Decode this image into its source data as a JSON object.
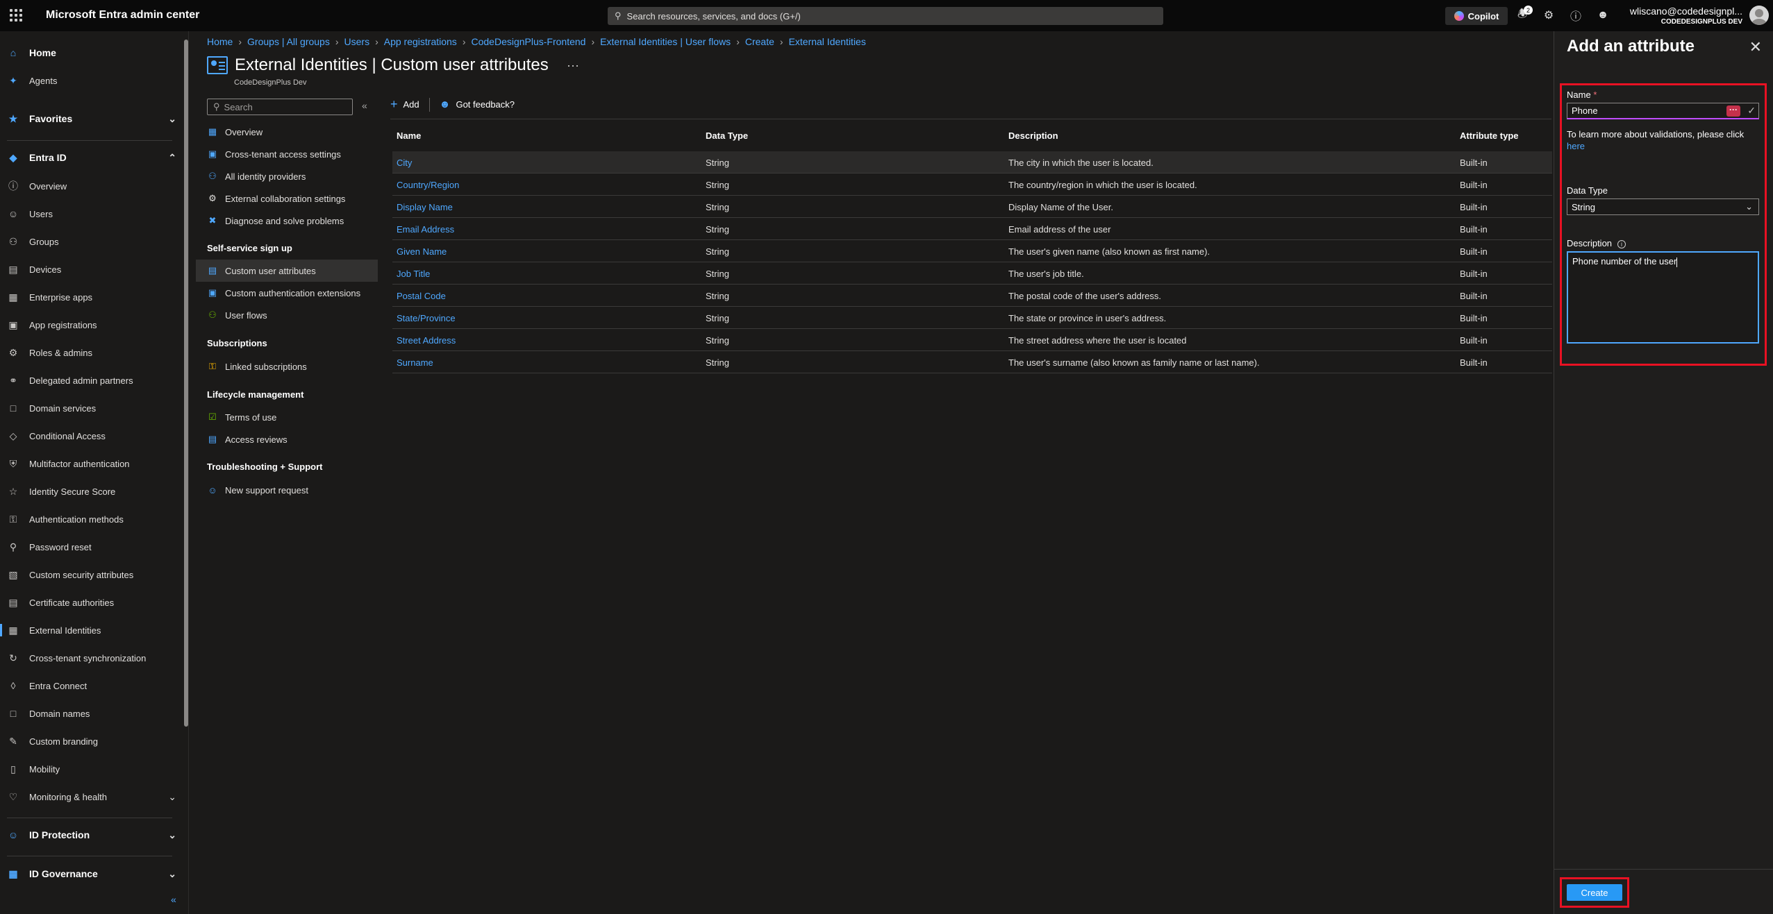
{
  "topbar": {
    "brand": "Microsoft Entra admin center",
    "search_placeholder": "Search resources, services, and docs (G+/)",
    "copilot_label": "Copilot",
    "notification_count": "2",
    "user_email": "wliscano@codedesignpl...",
    "user_tenant": "CODEDESIGNPLUS DEV"
  },
  "leftnav": {
    "home": "Home",
    "agents": "Agents",
    "favorites": "Favorites",
    "entra_id": "Entra ID",
    "items": [
      "Overview",
      "Users",
      "Groups",
      "Devices",
      "Enterprise apps",
      "App registrations",
      "Roles & admins",
      "Delegated admin partners",
      "Domain services",
      "Conditional Access",
      "Multifactor authentication",
      "Identity Secure Score",
      "Authentication methods",
      "Password reset",
      "Custom security attributes",
      "Certificate authorities",
      "External Identities",
      "Cross-tenant synchronization",
      "Entra Connect",
      "Domain names",
      "Custom branding",
      "Mobility",
      "Monitoring & health"
    ],
    "id_protection": "ID Protection",
    "id_governance": "ID Governance"
  },
  "breadcrumb": [
    "Home",
    "Groups | All groups",
    "Users",
    "App registrations",
    "CodeDesignPlus-Frontend",
    "External Identities | User flows",
    "Create",
    "External Identities"
  ],
  "page": {
    "title": "External Identities | Custom user attributes",
    "subtitle": "CodeDesignPlus Dev",
    "more": "···"
  },
  "inner_menu": {
    "search_placeholder": "Search",
    "top_items": [
      "Overview",
      "Cross-tenant access settings",
      "All identity providers",
      "External collaboration settings",
      "Diagnose and solve problems"
    ],
    "section_self_service": "Self-service sign up",
    "self_service_items": [
      "Custom user attributes",
      "Custom authentication extensions",
      "User flows"
    ],
    "section_subscriptions": "Subscriptions",
    "subscriptions_items": [
      "Linked subscriptions"
    ],
    "section_lifecycle": "Lifecycle management",
    "lifecycle_items": [
      "Terms of use",
      "Access reviews"
    ],
    "section_troubleshooting": "Troubleshooting + Support",
    "troubleshooting_items": [
      "New support request"
    ]
  },
  "toolbar": {
    "add_label": "Add",
    "feedback_label": "Got feedback?"
  },
  "table": {
    "headers": [
      "Name",
      "Data Type",
      "Description",
      "Attribute type"
    ],
    "rows": [
      [
        "City",
        "String",
        "The city in which the user is located.",
        "Built-in"
      ],
      [
        "Country/Region",
        "String",
        "The country/region in which the user is located.",
        "Built-in"
      ],
      [
        "Display Name",
        "String",
        "Display Name of the User.",
        "Built-in"
      ],
      [
        "Email Address",
        "String",
        "Email address of the user",
        "Built-in"
      ],
      [
        "Given Name",
        "String",
        "The user's given name (also known as first name).",
        "Built-in"
      ],
      [
        "Job Title",
        "String",
        "The user's job title.",
        "Built-in"
      ],
      [
        "Postal Code",
        "String",
        "The postal code of the user's address.",
        "Built-in"
      ],
      [
        "State/Province",
        "String",
        "The state or province in user's address.",
        "Built-in"
      ],
      [
        "Street Address",
        "String",
        "The street address where the user is located",
        "Built-in"
      ],
      [
        "Surname",
        "String",
        "The user's surname (also known as family name or last name).",
        "Built-in"
      ]
    ]
  },
  "panel": {
    "title": "Add an attribute",
    "name_label": "Name",
    "required_mark": "*",
    "name_value": "Phone",
    "help_text": "To learn more about validations, please click",
    "help_link": "here",
    "data_type_label": "Data Type",
    "data_type_value": "String",
    "description_label": "Description",
    "description_value": "Phone number of the user",
    "create_label": "Create"
  },
  "colors": {
    "accent": "#4fa8ff",
    "highlight_border": "#e81123",
    "primary_button": "#2899f5"
  }
}
